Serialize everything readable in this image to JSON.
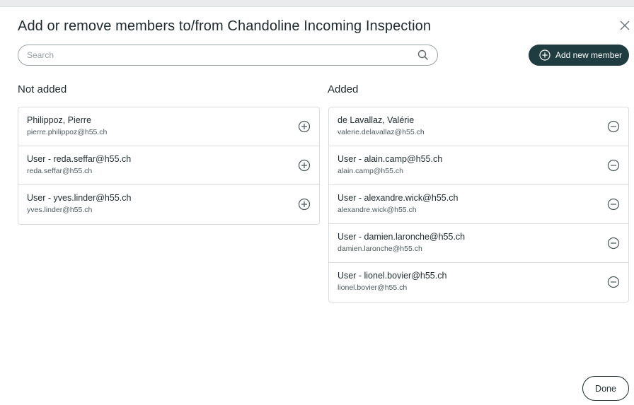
{
  "dialog": {
    "title": "Add or remove members to/from Chandoline Incoming Inspection"
  },
  "search": {
    "placeholder": "Search",
    "value": ""
  },
  "toolbar": {
    "add_member_label": "Add new member"
  },
  "not_added": {
    "heading": "Not added",
    "members": [
      {
        "name": "Philippoz, Pierre",
        "email": "pierre.philippoz@h55.ch"
      },
      {
        "name": "User - reda.seffar@h55.ch",
        "email": "reda.seffar@h55.ch"
      },
      {
        "name": "User - yves.linder@h55.ch",
        "email": "yves.linder@h55.ch"
      }
    ]
  },
  "added": {
    "heading": "Added",
    "members": [
      {
        "name": "de Lavallaz, Valérie",
        "email": "valerie.delavallaz@h55.ch"
      },
      {
        "name": "User - alain.camp@h55.ch",
        "email": "alain.camp@h55.ch"
      },
      {
        "name": "User - alexandre.wick@h55.ch",
        "email": "alexandre.wick@h55.ch"
      },
      {
        "name": "User - damien.laronche@h55.ch",
        "email": "damien.laronche@h55.ch"
      },
      {
        "name": "User - lionel.bovier@h55.ch",
        "email": "lionel.bovier@h55.ch"
      }
    ]
  },
  "footer": {
    "done_label": "Done"
  },
  "icons": {
    "close": "close-icon",
    "search": "search-icon",
    "add": "plus-circle-icon",
    "remove": "minus-circle-icon"
  },
  "colors": {
    "primary": "#1f3c41",
    "text": "#1f2a2e",
    "border": "#dadee0"
  }
}
